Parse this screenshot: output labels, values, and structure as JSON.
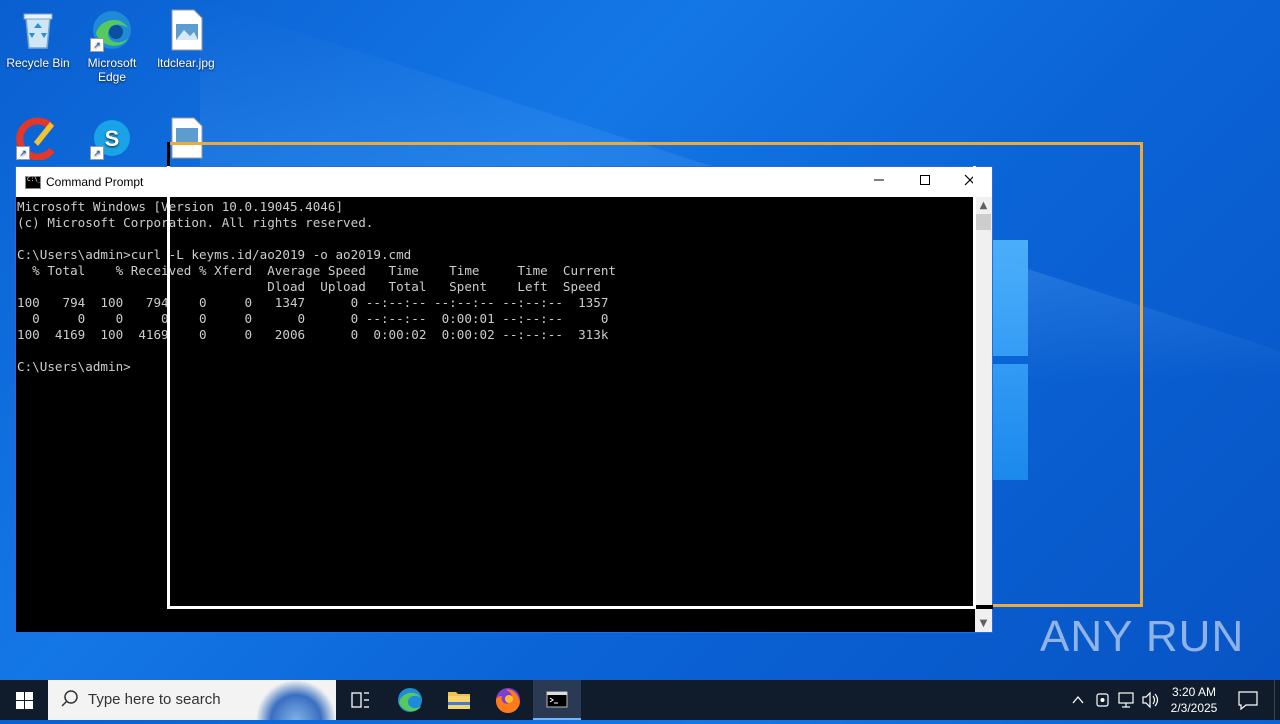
{
  "desktop": {
    "icons": [
      {
        "label": "Recycle Bin"
      },
      {
        "label": "Microsoft Edge"
      },
      {
        "label": "ltdclear.jpg"
      }
    ]
  },
  "cmd": {
    "title": "Command Prompt",
    "lines": [
      "Microsoft Windows [Version 10.0.19045.4046]",
      "(c) Microsoft Corporation. All rights reserved.",
      "",
      "C:\\Users\\admin>curl -L keyms.id/ao2019 -o ao2019.cmd",
      "  % Total    % Received % Xferd  Average Speed   Time    Time     Time  Current",
      "                                 Dload  Upload   Total   Spent    Left  Speed",
      "100   794  100   794    0     0   1347      0 --:--:-- --:--:-- --:--:--  1357",
      "  0     0    0     0    0     0      0      0 --:--:--  0:00:01 --:--:--     0",
      "100  4169  100  4169    0     0   2006      0  0:00:02  0:00:02 --:--:--  313k",
      "",
      "C:\\Users\\admin>"
    ]
  },
  "watermark": "ANY RUN",
  "taskbar": {
    "search_placeholder": "Type here to search",
    "time": "3:20 AM",
    "date": "2/3/2025"
  },
  "colors": {
    "highlight_orange": "#f0a936",
    "console_text": "#cccccc",
    "taskbar_bg": "#101c2c"
  }
}
